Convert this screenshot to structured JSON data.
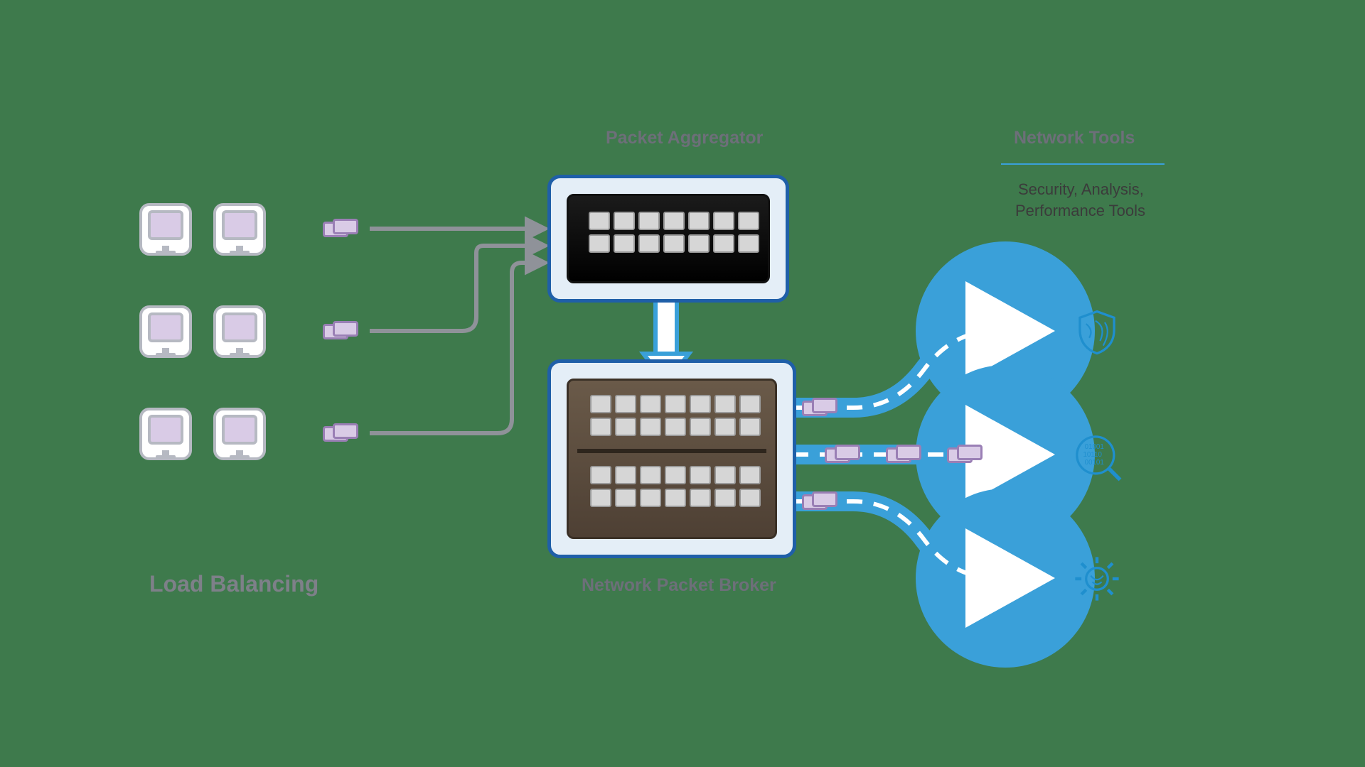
{
  "labels": {
    "load_balancing": "Load Balancing",
    "packet_aggregator": "Packet Aggregator",
    "network_packet_broker": "Network Packet Broker",
    "network_tools": "Network Tools",
    "tools_subtitle_l1": "Security, Analysis,",
    "tools_subtitle_l2": "Performance Tools"
  },
  "colors": {
    "bg": "#3e7a4c",
    "accent": "#1f5fa8",
    "flow": "#3aa0d9",
    "purple": "#b79cc9",
    "gray": "#8f9299"
  },
  "left_sources": {
    "row_count": 3,
    "monitors_per_row": 2,
    "tap_per_row": 1
  },
  "center_devices": {
    "aggregator": {
      "port_rows": 2,
      "ports_per_row": 7,
      "style": "black"
    },
    "broker": {
      "port_rows": 4,
      "ports_per_row": 7,
      "style": "brown"
    }
  },
  "right_tools": {
    "items": [
      "security-shield",
      "data-analysis",
      "performance-gear"
    ]
  },
  "flow": {
    "left_to_aggregator": 3,
    "aggregator_to_broker": 1,
    "broker_to_tools": 3,
    "taps_on_middle_output": 3,
    "taps_on_top_output": 1,
    "taps_on_bottom_output": 1
  }
}
